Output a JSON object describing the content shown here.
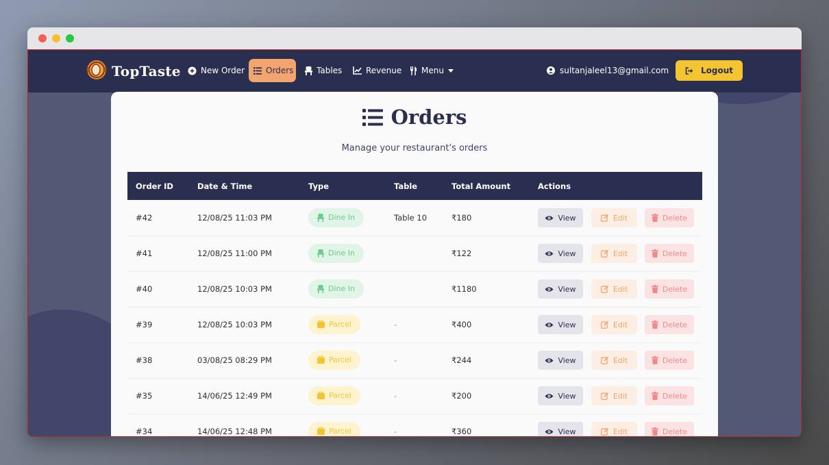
{
  "navbar": {
    "brand": "TopTaste",
    "links": [
      {
        "label": "New Order",
        "icon": "plus-circle-icon"
      },
      {
        "label": "Orders",
        "icon": "list-icon",
        "active": true
      },
      {
        "label": "Tables",
        "icon": "chair-icon"
      },
      {
        "label": "Revenue",
        "icon": "chart-line-icon"
      },
      {
        "label": "Menu",
        "icon": "utensils-icon"
      }
    ],
    "user_email": "sultanjaleel13@gmail.com",
    "logout_label": "Logout"
  },
  "page": {
    "title": "Orders",
    "subtitle": "Manage your restaurant's orders"
  },
  "table": {
    "headers": [
      "Order ID",
      "Date & Time",
      "Type",
      "Table",
      "Total Amount",
      "Actions"
    ],
    "rows": [
      {
        "id": "#42",
        "datetime": "12/08/25 11:03 PM",
        "type": "Dine In",
        "table": "Table 10",
        "amount": "₹180"
      },
      {
        "id": "#41",
        "datetime": "12/08/25 11:00 PM",
        "type": "Dine In",
        "table": "",
        "amount": "₹122"
      },
      {
        "id": "#40",
        "datetime": "12/08/25 10:03 PM",
        "type": "Dine In",
        "table": "",
        "amount": "₹1180"
      },
      {
        "id": "#39",
        "datetime": "12/08/25 10:03 PM",
        "type": "Parcel",
        "table": "-",
        "amount": "₹400"
      },
      {
        "id": "#38",
        "datetime": "03/08/25 08:29 PM",
        "type": "Parcel",
        "table": "-",
        "amount": "₹244"
      },
      {
        "id": "#35",
        "datetime": "14/06/25 12:49 PM",
        "type": "Parcel",
        "table": "-",
        "amount": "₹200"
      },
      {
        "id": "#34",
        "datetime": "14/06/25 12:48 PM",
        "type": "Parcel",
        "table": "-",
        "amount": "₹360"
      }
    ],
    "actions": {
      "view": "View",
      "edit": "Edit",
      "delete": "Delete"
    }
  },
  "colors": {
    "navbar_bg": "#2b2f4f",
    "active_link": "#f2a56e",
    "logout_bg": "#f5c531",
    "dine_in_bg": "#e1f4e8",
    "dine_in_fg": "#6bcb8b",
    "parcel_bg": "#fdf3cf",
    "parcel_fg": "#f5c531"
  }
}
